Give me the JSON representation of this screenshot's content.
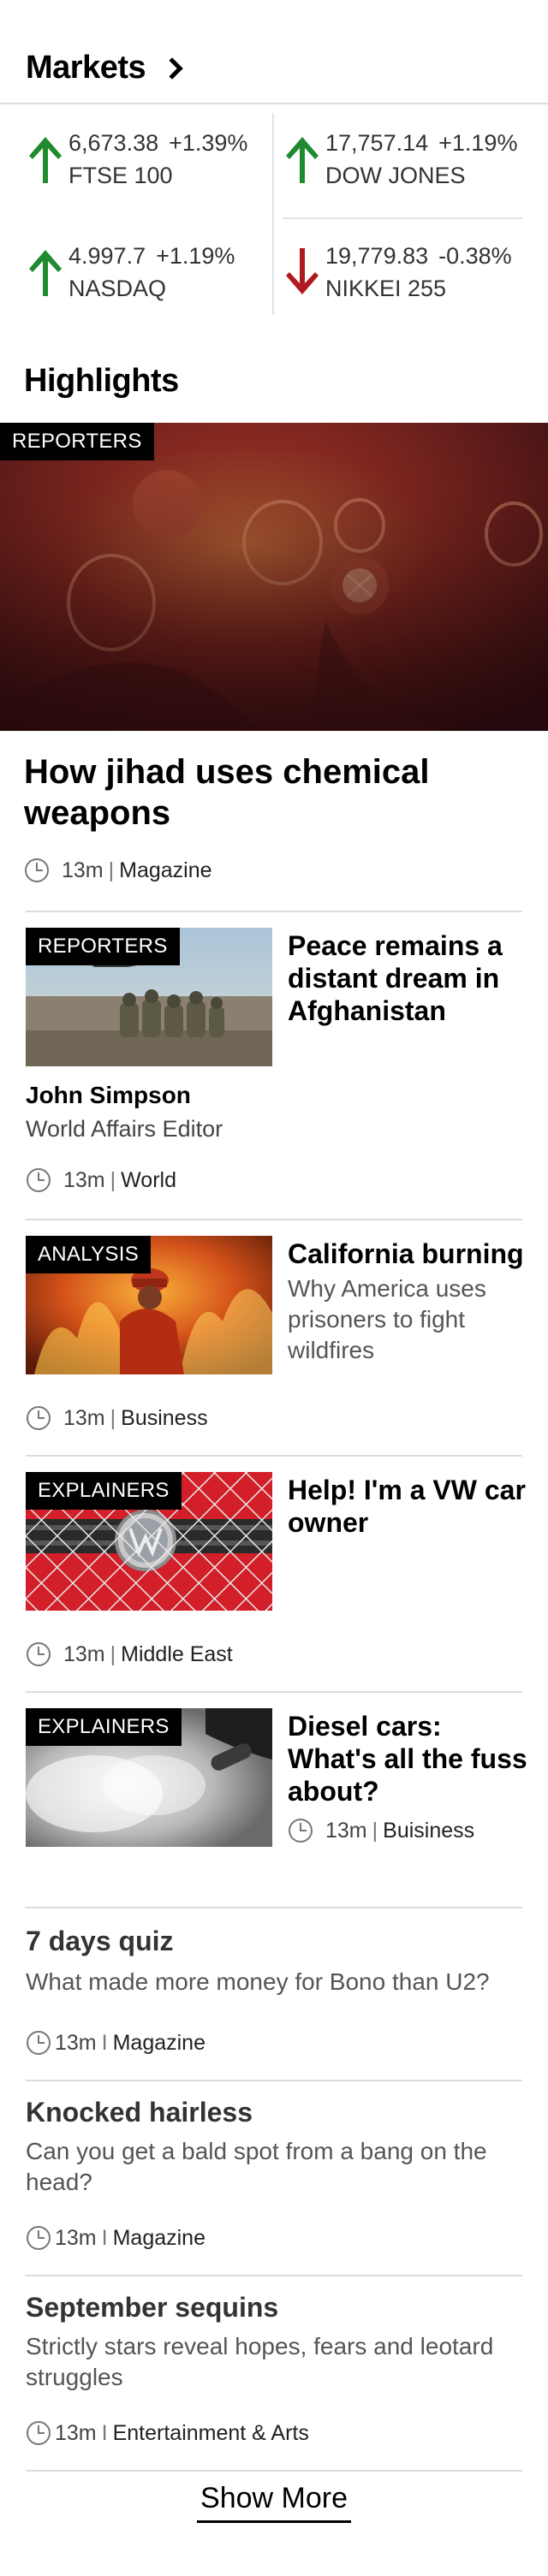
{
  "markets": {
    "title": "Markets",
    "items": [
      {
        "value": "6,673.38",
        "change": "+1.39%",
        "name": "FTSE 100",
        "direction": "up"
      },
      {
        "value": "17,757.14",
        "change": "+1.19%",
        "name": "DOW JONES",
        "direction": "up"
      },
      {
        "value": "4.997.7",
        "change": "+1.19%",
        "name": "NASDAQ",
        "direction": "up"
      },
      {
        "value": "19,779.83",
        "change": "-0.38%",
        "name": "NIKKEI 255",
        "direction": "down"
      }
    ],
    "colors": {
      "up": "#1f8a2e",
      "down": "#b0191e"
    }
  },
  "highlights": {
    "title": "Highlights",
    "hero": {
      "tag": "REPORTERS",
      "title": "How jihad uses chemical weapons",
      "time": "13m",
      "section": "Magazine"
    },
    "stories": [
      {
        "tag": "REPORTERS",
        "title": "Peace remains a distant dream in Afghanistan",
        "author": "John Simpson",
        "author_role": "World Affairs Editor",
        "time": "13m",
        "section": "World"
      },
      {
        "tag": "ANALYSIS",
        "title": "California burning",
        "summary": "Why America uses prisoners to fight wildfires",
        "time": "13m",
        "section": "Business"
      },
      {
        "tag": "EXPLAINERS",
        "title": "Help! I'm a VW car owner",
        "time": "13m",
        "section": "Middle East"
      },
      {
        "tag": "EXPLAINERS",
        "title": "Diesel cars: What's all the fuss about?",
        "time": "13m",
        "section": "Buisiness"
      }
    ],
    "plain": [
      {
        "title": "7 days quiz",
        "summary": "What made more money for Bono than U2?",
        "time": "13m",
        "section": "Magazine"
      },
      {
        "title": "Knocked hairless",
        "summary": "Can you get a bald spot from a bang on the head?",
        "time": "13m",
        "section": "Magazine"
      },
      {
        "title": "September sequins",
        "summary": "Strictly stars reveal hopes, fears and leotard struggles",
        "time": "13m",
        "section": "Entertainment & Arts"
      }
    ],
    "separators": {
      "pipe": "|",
      "plain": "I"
    }
  },
  "show_more": "Show More"
}
